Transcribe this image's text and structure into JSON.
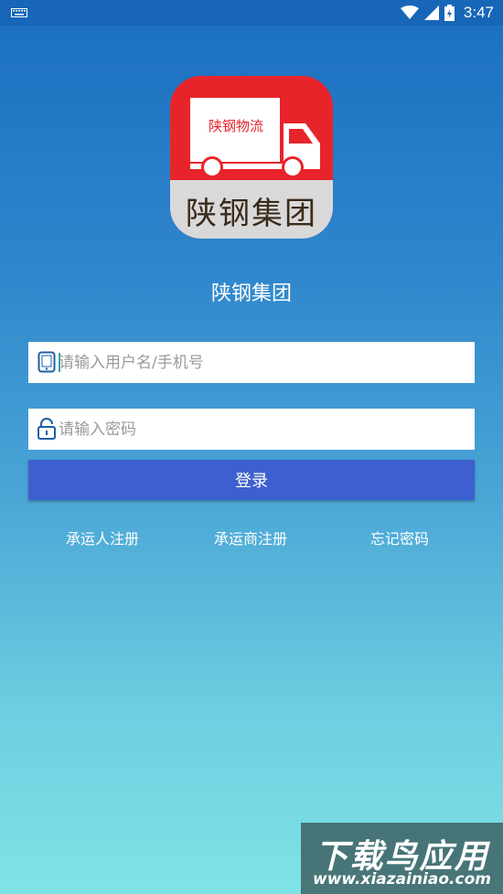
{
  "status_bar": {
    "time": "3:47",
    "icons": [
      "keyboard-icon",
      "wifi-icon",
      "signal-icon",
      "battery-icon"
    ]
  },
  "logo": {
    "truck_text": "陕钢物流",
    "band_text": "陕钢集团",
    "color": "#e8242b"
  },
  "app_title": "陕钢集团",
  "form": {
    "username_placeholder": "请输入用户名/手机号",
    "username_value": "",
    "password_placeholder": "请输入密码",
    "password_value": "",
    "login_label": "登录"
  },
  "links": {
    "carrier_register": "承运人注册",
    "carrier_company_register": "承运商注册",
    "forgot_password": "忘记密码"
  },
  "watermark": {
    "main": "下载鸟应用",
    "sub": "www.xiazainiao.com"
  },
  "colors": {
    "accent": "#3e5fcf",
    "status_bar": "#1866b8"
  }
}
